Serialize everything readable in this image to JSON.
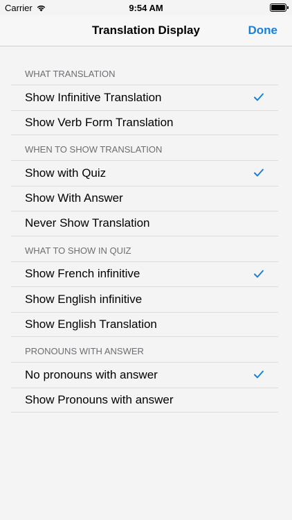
{
  "status": {
    "carrier": "Carrier",
    "time": "9:54 AM"
  },
  "nav": {
    "title": "Translation Display",
    "done": "Done"
  },
  "accent": "#1a7fd8",
  "sections": [
    {
      "header": "WHAT TRANSLATION",
      "rows": [
        {
          "label": "Show Infinitive Translation",
          "checked": true
        },
        {
          "label": "Show Verb Form Translation",
          "checked": false
        }
      ]
    },
    {
      "header": "WHEN TO SHOW TRANSLATION",
      "rows": [
        {
          "label": "Show with Quiz",
          "checked": true
        },
        {
          "label": "Show With Answer",
          "checked": false
        },
        {
          "label": "Never Show Translation",
          "checked": false
        }
      ]
    },
    {
      "header": "WHAT TO SHOW IN QUIZ",
      "rows": [
        {
          "label": "Show French infinitive",
          "checked": true
        },
        {
          "label": "Show English infinitive",
          "checked": false
        },
        {
          "label": "Show English Translation",
          "checked": false
        }
      ]
    },
    {
      "header": "PRONOUNS WITH ANSWER",
      "rows": [
        {
          "label": "No pronouns with answer",
          "checked": true
        },
        {
          "label": "Show Pronouns with answer",
          "checked": false
        }
      ]
    }
  ]
}
